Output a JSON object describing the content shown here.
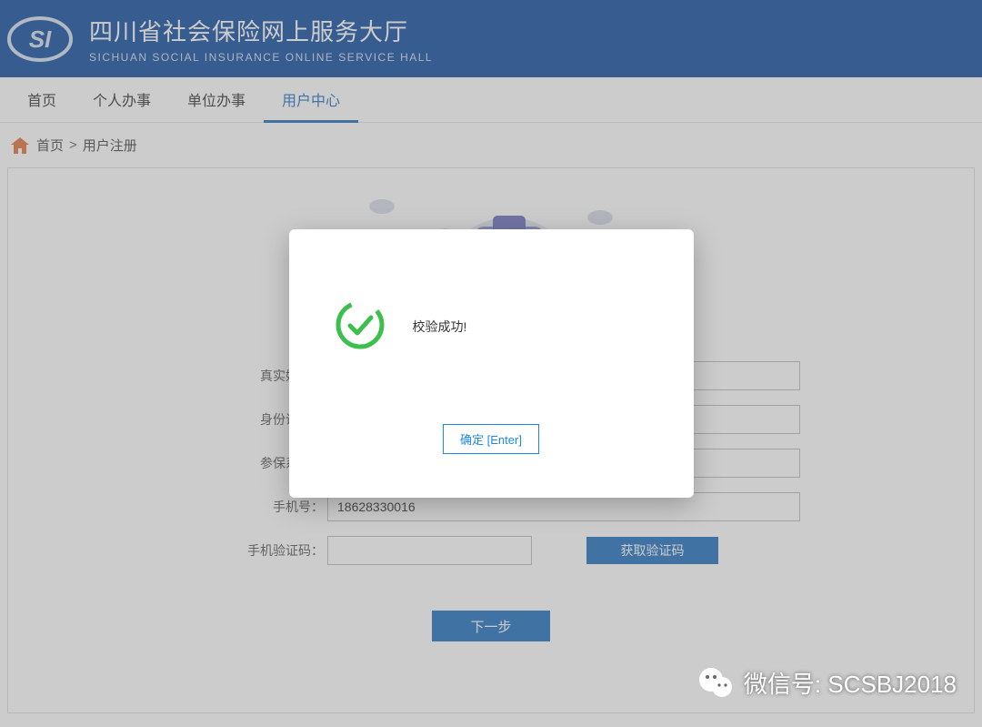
{
  "header": {
    "title_cn": "四川省社会保险网上服务大厅",
    "title_en": "SICHUAN  SOCIAL  INSURANCE  ONLINE  SERVICE  HALL"
  },
  "nav": {
    "items": [
      "首页",
      "个人办事",
      "单位办事",
      "用户中心"
    ],
    "active_index": 3
  },
  "breadcrumb": {
    "home": "首页",
    "current": "用户注册"
  },
  "form": {
    "real_name_label": "真实姓名：",
    "id_card_label": "身份证号：",
    "system_label": "参保系统：",
    "phone_label": "手机号：",
    "phone_value": "18628330016",
    "sms_code_label": "手机验证码：",
    "get_code_label": "获取验证码",
    "next_label": "下一步"
  },
  "dialog": {
    "message": "校验成功!",
    "button_label": "确定 [Enter]"
  },
  "watermark": {
    "text": "微信号: SCSBJ2018"
  }
}
